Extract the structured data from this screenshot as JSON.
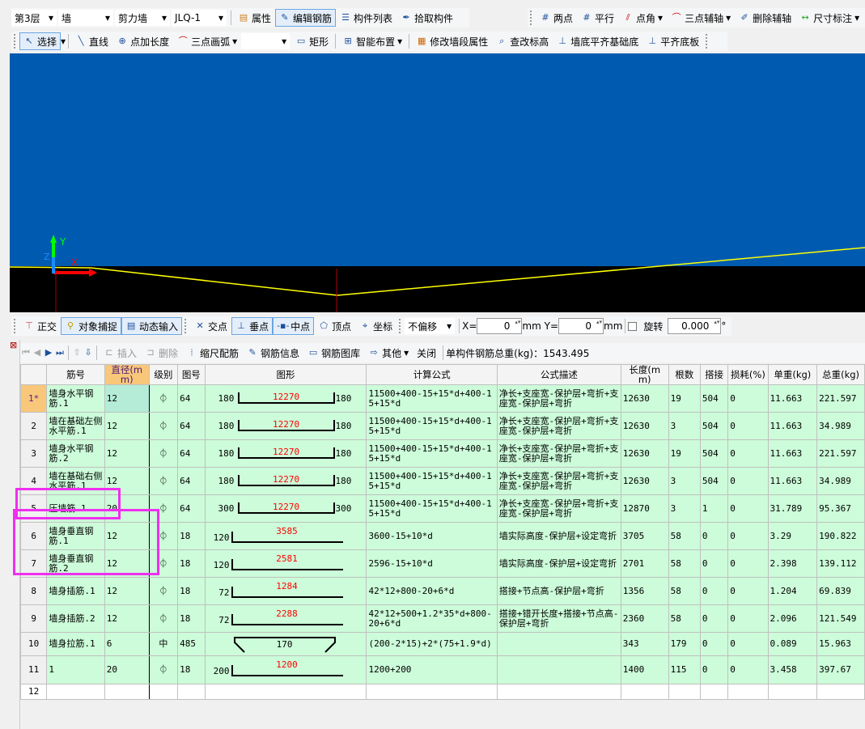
{
  "toolbar1": {
    "floor": "第3层",
    "type": "墙",
    "subtype": "剪力墙",
    "component": "JLQ-1",
    "props": "属性",
    "edit_rebar": "编辑钢筋",
    "list": "构件列表",
    "pick": "拾取构件",
    "two_point": "两点",
    "parallel": "平行",
    "point_angle": "点角",
    "three_point_axis": "三点辅轴",
    "delete_axis": "删除辅轴",
    "dimension": "尺寸标注"
  },
  "toolbar2": {
    "select": "选择",
    "line": "直线",
    "point_length": "点加长度",
    "arc": "三点画弧",
    "rect": "矩形",
    "smart": "智能布置",
    "modify_wall": "修改墙段属性",
    "check_elev": "查改标高",
    "align_base": "墙底平齐基础底",
    "align_slab": "平齐底板"
  },
  "canvas": {
    "axis_y": "Y",
    "axis_x": "X",
    "axis_z": "Z"
  },
  "toolbar3": {
    "ortho": "正交",
    "snap": "对象捕捉",
    "dynamic": "动态输入",
    "intersect": "交点",
    "perp": "垂点",
    "mid": "中点",
    "vertex": "顶点",
    "coord": "坐标",
    "offset": "不偏移",
    "x_label": "X=",
    "x_value": "0",
    "y_label": "Y=",
    "y_value": "0",
    "unit": "mm",
    "rotate": "旋转",
    "rotate_value": "0.000",
    "degree": "°"
  },
  "toolbar4": {
    "insert": "插入",
    "delete": "删除",
    "scale": "缩尺配筋",
    "info": "钢筋信息",
    "library": "钢筋图库",
    "other": "其他",
    "close": "关闭",
    "total": "单构件钢筋总重(kg)：1543.495"
  },
  "table": {
    "headers": [
      "",
      "筋号",
      "直径(mm)",
      "级别",
      "图号",
      "图形",
      "计算公式",
      "公式描述",
      "长度(mm)",
      "根数",
      "搭接",
      "损耗(%)",
      "单重(kg)",
      "总重(kg)"
    ],
    "rows": [
      {
        "n": "1*",
        "name": "墙身水平钢筋.1",
        "d": "12",
        "grade": "⏀",
        "fig": "64",
        "shape": {
          "kind": "U",
          "left": "180",
          "mid": "12270",
          "right": "180"
        },
        "formula": "11500+400-15+15*d+400-15+15*d",
        "desc": "净长+支座宽-保护层+弯折+支座宽-保护层+弯折",
        "len": "12630",
        "count": "19",
        "lap": "504",
        "loss": "0",
        "unit": "11.663",
        "total": "221.597"
      },
      {
        "n": "2",
        "name": "墙在基础左侧水平筋.1",
        "d": "12",
        "grade": "⏀",
        "fig": "64",
        "shape": {
          "kind": "U",
          "left": "180",
          "mid": "12270",
          "right": "180"
        },
        "formula": "11500+400-15+15*d+400-15+15*d",
        "desc": "净长+支座宽-保护层+弯折+支座宽-保护层+弯折",
        "len": "12630",
        "count": "3",
        "lap": "504",
        "loss": "0",
        "unit": "11.663",
        "total": "34.989"
      },
      {
        "n": "3",
        "name": "墙身水平钢筋.2",
        "d": "12",
        "grade": "⏀",
        "fig": "64",
        "shape": {
          "kind": "U",
          "left": "180",
          "mid": "12270",
          "right": "180"
        },
        "formula": "11500+400-15+15*d+400-15+15*d",
        "desc": "净长+支座宽-保护层+弯折+支座宽-保护层+弯折",
        "len": "12630",
        "count": "19",
        "lap": "504",
        "loss": "0",
        "unit": "11.663",
        "total": "221.597"
      },
      {
        "n": "4",
        "name": "墙在基础右侧水平筋.1",
        "d": "12",
        "grade": "⏀",
        "fig": "64",
        "shape": {
          "kind": "U",
          "left": "180",
          "mid": "12270",
          "right": "180"
        },
        "formula": "11500+400-15+15*d+400-15+15*d",
        "desc": "净长+支座宽-保护层+弯折+支座宽-保护层+弯折",
        "len": "12630",
        "count": "3",
        "lap": "504",
        "loss": "0",
        "unit": "11.663",
        "total": "34.989"
      },
      {
        "n": "5",
        "name": "压墙筋.1",
        "d": "20",
        "grade": "⏀",
        "fig": "64",
        "shape": {
          "kind": "U",
          "left": "300",
          "mid": "12270",
          "right": "300"
        },
        "formula": "11500+400-15+15*d+400-15+15*d",
        "desc": "净长+支座宽-保护层+弯折+支座宽-保护层+弯折",
        "len": "12870",
        "count": "3",
        "lap": "1",
        "loss": "0",
        "unit": "31.789",
        "total": "95.367"
      },
      {
        "n": "6",
        "name": "墙身垂直钢筋.1",
        "d": "12",
        "grade": "⏀",
        "fig": "18",
        "shape": {
          "kind": "L",
          "left": "120",
          "mid": "3585"
        },
        "formula": "3600-15+10*d",
        "desc": "墙实际高度-保护层+设定弯折",
        "len": "3705",
        "count": "58",
        "lap": "0",
        "loss": "0",
        "unit": "3.29",
        "total": "190.822"
      },
      {
        "n": "7",
        "name": "墙身垂直钢筋.2",
        "d": "12",
        "grade": "⏀",
        "fig": "18",
        "shape": {
          "kind": "L",
          "left": "120",
          "mid": "2581"
        },
        "formula": "2596-15+10*d",
        "desc": "墙实际高度-保护层+设定弯折",
        "len": "2701",
        "count": "58",
        "lap": "0",
        "loss": "0",
        "unit": "2.398",
        "total": "139.112"
      },
      {
        "n": "8",
        "name": "墙身插筋.1",
        "d": "12",
        "grade": "⏀",
        "fig": "18",
        "shape": {
          "kind": "L",
          "left": "72",
          "mid": "1284"
        },
        "formula": "42*12+800-20+6*d",
        "desc": "搭接+节点高-保护层+弯折",
        "len": "1356",
        "count": "58",
        "lap": "0",
        "loss": "0",
        "unit": "1.204",
        "total": "69.839"
      },
      {
        "n": "9",
        "name": "墙身插筋.2",
        "d": "12",
        "grade": "⏀",
        "fig": "18",
        "shape": {
          "kind": "L",
          "left": "72",
          "mid": "2288"
        },
        "formula": "42*12+500+1.2*35*d+800-20+6*d",
        "desc": "搭接+错开长度+搭接+节点高-保护层+弯折",
        "len": "2360",
        "count": "58",
        "lap": "0",
        "loss": "0",
        "unit": "2.096",
        "total": "121.549"
      },
      {
        "n": "10",
        "name": "墙身拉筋.1",
        "d": "6",
        "grade": "中",
        "fig": "485",
        "shape": {
          "kind": "tie",
          "mid": "170"
        },
        "formula": "(200-2*15)+2*(75+1.9*d)",
        "desc": "",
        "len": "343",
        "count": "179",
        "lap": "0",
        "loss": "0",
        "unit": "0.089",
        "total": "15.963"
      },
      {
        "n": "11",
        "name": "1",
        "d": "20",
        "grade": "⏀",
        "fig": "18",
        "shape": {
          "kind": "L",
          "left": "200",
          "mid": "1200"
        },
        "formula": "1200+200",
        "desc": "",
        "len": "1400",
        "count": "115",
        "lap": "0",
        "loss": "0",
        "unit": "3.458",
        "total": "397.67"
      },
      {
        "n": "12",
        "name": "",
        "d": "",
        "grade": "",
        "fig": "",
        "shape": null,
        "formula": "",
        "desc": "",
        "len": "",
        "count": "",
        "lap": "",
        "loss": "",
        "unit": "",
        "total": ""
      }
    ]
  },
  "colors": {
    "canvas_blue": "#005bb0",
    "row_green": "#ccfcd9",
    "current_row": "#f8c77a",
    "highlight": "#f02ef0",
    "dimension_red": "#ff0000"
  }
}
